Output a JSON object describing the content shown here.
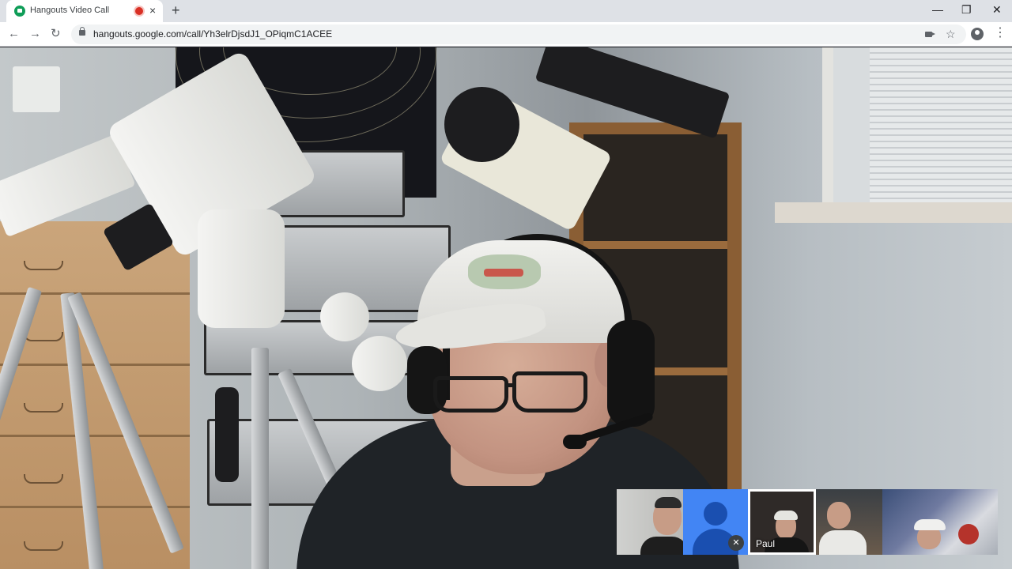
{
  "browser": {
    "tab_title": "Hangouts Video Call",
    "tab_close": "×",
    "new_tab": "+",
    "url": "hangouts.google.com/call/Yh3elrDjsdJ1_OPiqmC1ACEE",
    "nav_back": "←",
    "nav_forward": "→",
    "nav_reload": "↻",
    "bookmark_star": "☆",
    "menu": "⋮",
    "window_minimize": "—",
    "window_restore": "❐",
    "window_close": "✕"
  },
  "call": {
    "participants": [
      {
        "id": "p1",
        "label": ""
      },
      {
        "id": "p2",
        "label": "",
        "muted": true,
        "mic_icon": "✕"
      },
      {
        "id": "p3",
        "label": "Paul",
        "active": true
      },
      {
        "id": "p4",
        "label": ""
      },
      {
        "id": "p5",
        "label": ""
      }
    ]
  },
  "colors": {
    "record_indicator": "#d93025",
    "hangouts_green": "#0f9d58",
    "avatar_blue": "#4285f4"
  }
}
